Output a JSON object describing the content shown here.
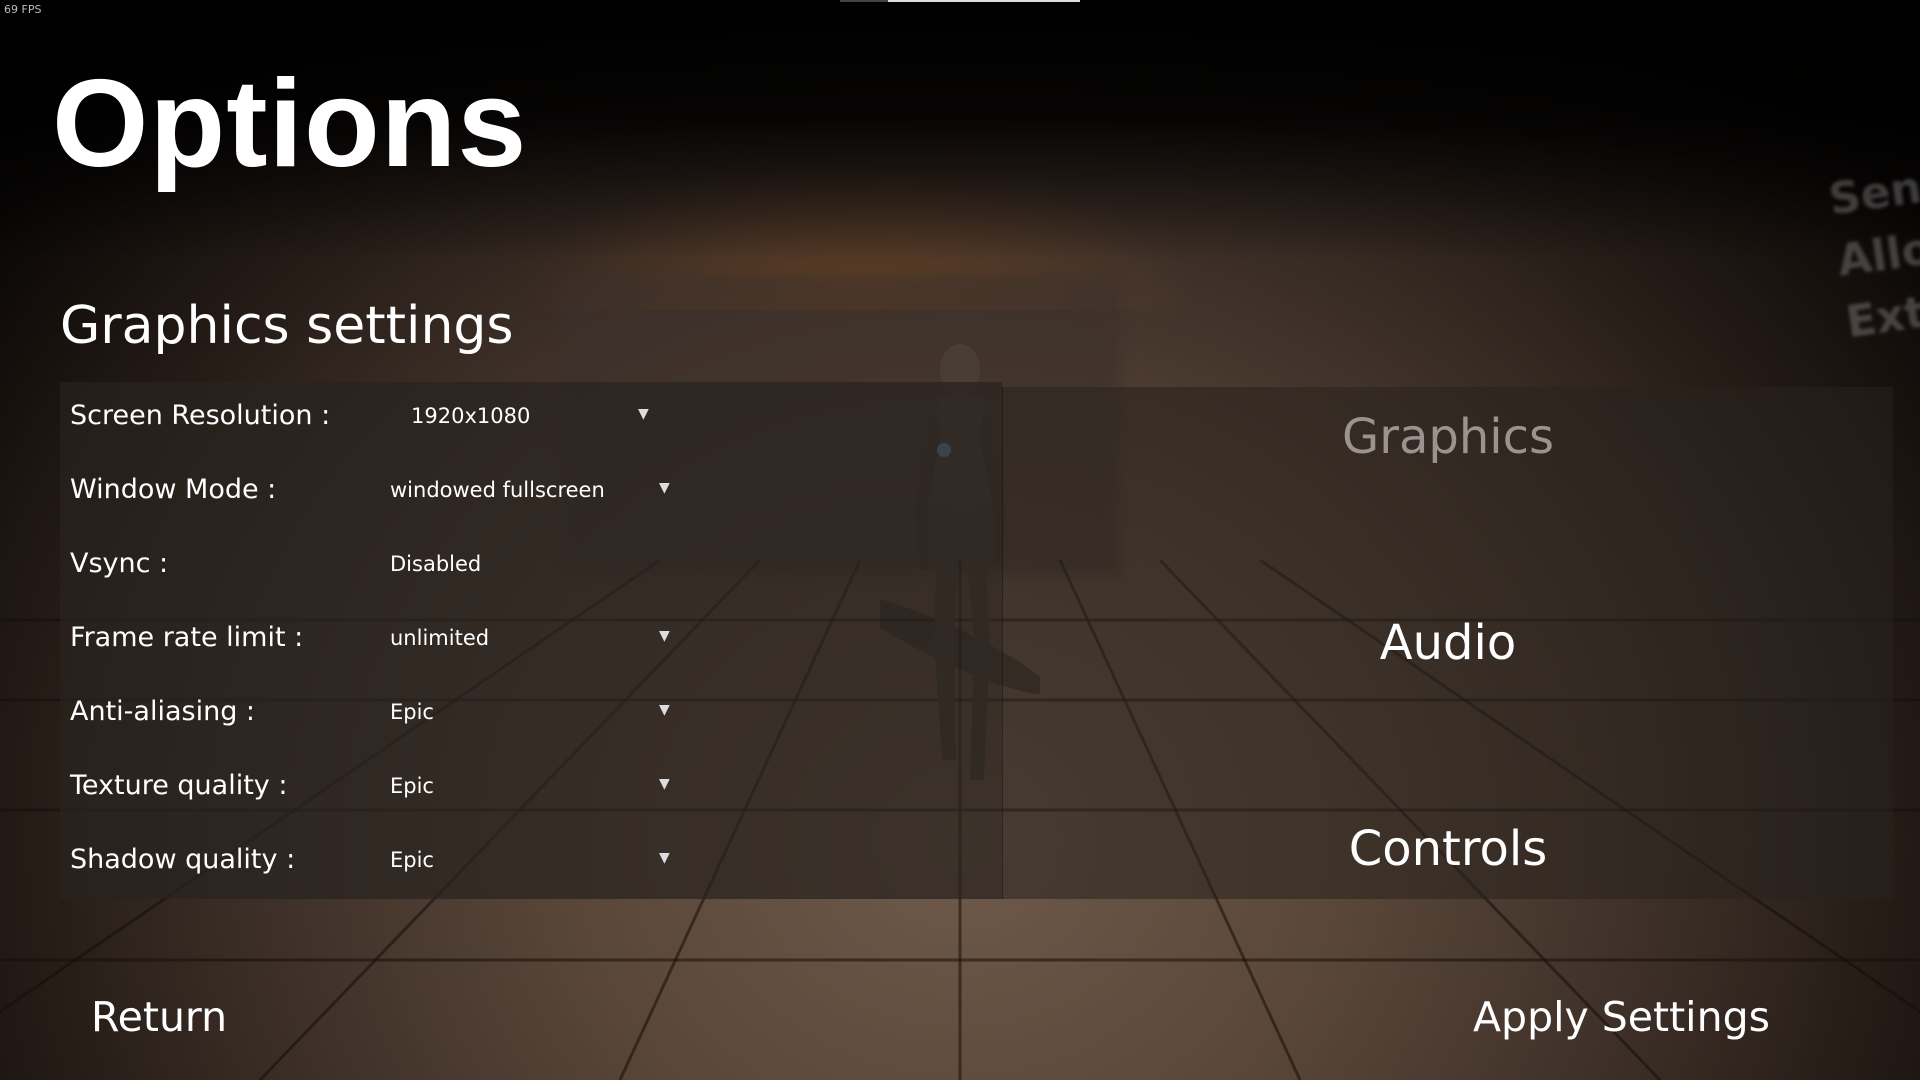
{
  "hud": {
    "fps": "69 FPS"
  },
  "header": {
    "title": "Options"
  },
  "section": {
    "title": "Graphics settings"
  },
  "background_text": {
    "lines": [
      "Sen",
      "Allo",
      "Extr"
    ]
  },
  "settings": {
    "rows": [
      {
        "label": "Screen Resolution :",
        "value": "1920x1080",
        "has_dropdown": true
      },
      {
        "label": "Window Mode :",
        "value": "windowed fullscreen",
        "has_dropdown": true
      },
      {
        "label": "Vsync :",
        "value": "Disabled",
        "has_dropdown": false
      },
      {
        "label": "Frame rate limit :",
        "value": "unlimited",
        "has_dropdown": true
      },
      {
        "label": "Anti-aliasing :",
        "value": "Epic",
        "has_dropdown": true
      },
      {
        "label": "Texture quality :",
        "value": "Epic",
        "has_dropdown": true
      },
      {
        "label": "Shadow quality :",
        "value": "Epic",
        "has_dropdown": true
      }
    ],
    "dropdown_icon": "chevron-down-icon"
  },
  "tabs": [
    {
      "label": "Graphics",
      "active": true
    },
    {
      "label": "Audio",
      "active": false
    },
    {
      "label": "Controls",
      "active": false
    }
  ],
  "footer": {
    "return_label": "Return",
    "apply_label": "Apply Settings"
  },
  "colors": {
    "text": "#ffffff",
    "inactive_tab": "#9a9390",
    "panel": "#28221e"
  }
}
